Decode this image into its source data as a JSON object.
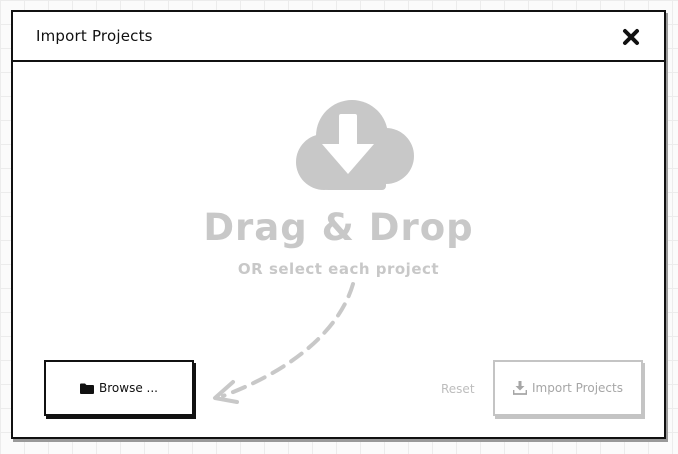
{
  "dialog": {
    "title": "Import Projects",
    "close_icon": "close-icon"
  },
  "dropzone": {
    "icon": "cloud-download-icon",
    "title": "Drag & Drop",
    "subtitle": "OR select each project"
  },
  "footer": {
    "browse": {
      "label": "Browse ...",
      "icon": "folder-icon"
    },
    "reset": {
      "label": "Reset"
    },
    "import": {
      "label": "Import Projects",
      "icon": "download-icon"
    }
  },
  "colors": {
    "border": "#111111",
    "muted": "#c8c8c8",
    "disabled": "#c4c4c4",
    "background": "#ffffff"
  }
}
